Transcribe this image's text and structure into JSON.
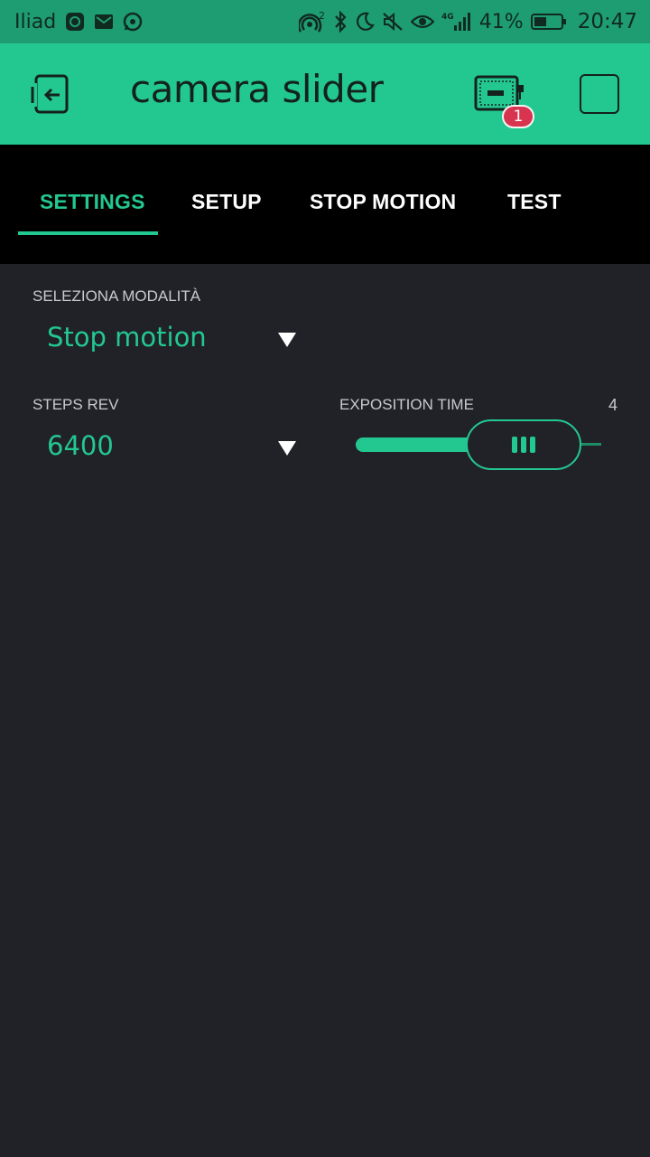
{
  "status_bar": {
    "carrier": "Iliad",
    "battery_percent": "41%",
    "time": "20:47",
    "network": "4G",
    "hotspot_superscript": "2",
    "icons": [
      "iliad-app-icon",
      "mail-icon",
      "whatsapp-icon",
      "hotspot-icon",
      "bluetooth-icon",
      "moon-icon",
      "mute-icon",
      "eye-icon",
      "signal-icon",
      "battery-icon"
    ]
  },
  "app_bar": {
    "title": "camera slider",
    "device_badge_count": "1"
  },
  "tabs": [
    {
      "label": "SETTINGS",
      "active": true
    },
    {
      "label": "SETUP",
      "active": false
    },
    {
      "label": "STOP MOTION",
      "active": false
    },
    {
      "label": "TEST",
      "active": false
    }
  ],
  "content": {
    "mode": {
      "label": "SELEZIONA MODALITÀ",
      "value": "Stop motion"
    },
    "steps": {
      "label": "STEPS REV",
      "value": "6400"
    },
    "exposition": {
      "label": "EXPOSITION TIME",
      "value": "4",
      "fill_fraction": 0.45
    }
  },
  "colors": {
    "accent": "#23c891",
    "status_bar": "#1e9d73",
    "background": "#212227",
    "tab_bar": "#000000",
    "badge": "#d8344f"
  }
}
